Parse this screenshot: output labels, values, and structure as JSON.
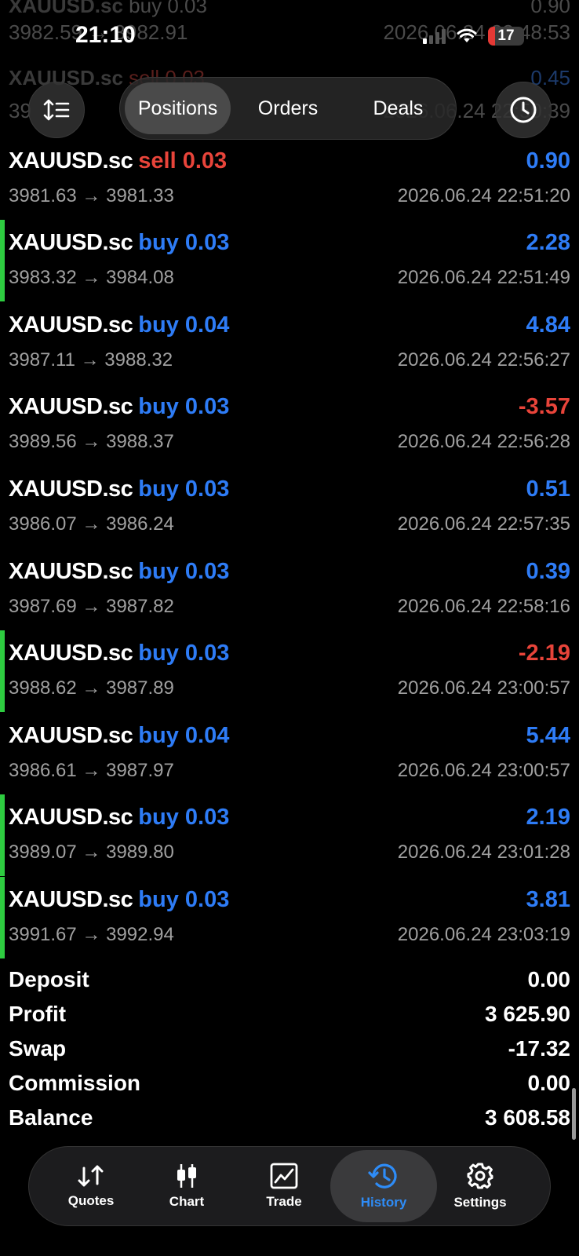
{
  "status_bar": {
    "time": "21:10",
    "battery": "17"
  },
  "ghost_rows": [
    {
      "symbol": "XAUUSD.sc",
      "side": "buy 0.03",
      "profit": "0.90",
      "prices": "3982.59 → 3982.91",
      "time": "2026.06.24 22:48:53"
    },
    {
      "symbol": "XAUUSD.sc",
      "side": "sell 0.03",
      "profit": "0.45",
      "prices": "39",
      "time": "2026.06.24 22:50:39"
    }
  ],
  "top_bar": {
    "tabs": [
      {
        "label": "Positions",
        "active": true
      },
      {
        "label": "Orders",
        "active": false
      },
      {
        "label": "Deals",
        "active": false
      }
    ]
  },
  "deals": [
    {
      "symbol": "XAUUSD.sc",
      "side": "sell",
      "side_label": "sell 0.03",
      "profit": "0.90",
      "sign": "pos",
      "prices": "3981.63 → 3981.33",
      "time": "2026.06.24 22:51:20",
      "marker": false
    },
    {
      "symbol": "XAUUSD.sc",
      "side": "buy",
      "side_label": "buy 0.03",
      "profit": "2.28",
      "sign": "pos",
      "prices": "3983.32 → 3984.08",
      "time": "2026.06.24 22:51:49",
      "marker": true
    },
    {
      "symbol": "XAUUSD.sc",
      "side": "buy",
      "side_label": "buy 0.04",
      "profit": "4.84",
      "sign": "pos",
      "prices": "3987.11 → 3988.32",
      "time": "2026.06.24 22:56:27",
      "marker": false
    },
    {
      "symbol": "XAUUSD.sc",
      "side": "buy",
      "side_label": "buy 0.03",
      "profit": "-3.57",
      "sign": "neg",
      "prices": "3989.56 → 3988.37",
      "time": "2026.06.24 22:56:28",
      "marker": false
    },
    {
      "symbol": "XAUUSD.sc",
      "side": "buy",
      "side_label": "buy 0.03",
      "profit": "0.51",
      "sign": "pos",
      "prices": "3986.07 → 3986.24",
      "time": "2026.06.24 22:57:35",
      "marker": false
    },
    {
      "symbol": "XAUUSD.sc",
      "side": "buy",
      "side_label": "buy 0.03",
      "profit": "0.39",
      "sign": "pos",
      "prices": "3987.69 → 3987.82",
      "time": "2026.06.24 22:58:16",
      "marker": false
    },
    {
      "symbol": "XAUUSD.sc",
      "side": "buy",
      "side_label": "buy 0.03",
      "profit": "-2.19",
      "sign": "neg",
      "prices": "3988.62 → 3987.89",
      "time": "2026.06.24 23:00:57",
      "marker": true
    },
    {
      "symbol": "XAUUSD.sc",
      "side": "buy",
      "side_label": "buy 0.04",
      "profit": "5.44",
      "sign": "pos",
      "prices": "3986.61 → 3987.97",
      "time": "2026.06.24 23:00:57",
      "marker": false
    },
    {
      "symbol": "XAUUSD.sc",
      "side": "buy",
      "side_label": "buy 0.03",
      "profit": "2.19",
      "sign": "pos",
      "prices": "3989.07 → 3989.80",
      "time": "2026.06.24 23:01:28",
      "marker": true
    },
    {
      "symbol": "XAUUSD.sc",
      "side": "buy",
      "side_label": "buy 0.03",
      "profit": "3.81",
      "sign": "pos",
      "prices": "3991.67 → 3992.94",
      "time": "2026.06.24 23:03:19",
      "marker": true
    }
  ],
  "summary": [
    {
      "label": "Deposit",
      "value": "0.00"
    },
    {
      "label": "Profit",
      "value": "3 625.90"
    },
    {
      "label": "Swap",
      "value": "-17.32"
    },
    {
      "label": "Commission",
      "value": "0.00"
    },
    {
      "label": "Balance",
      "value": "3 608.58"
    }
  ],
  "tabbar": [
    {
      "label": "Quotes",
      "icon": "quotes-icon",
      "active": false
    },
    {
      "label": "Chart",
      "icon": "chart-icon",
      "active": false
    },
    {
      "label": "Trade",
      "icon": "trade-icon",
      "active": false
    },
    {
      "label": "History",
      "icon": "history-icon",
      "active": true
    },
    {
      "label": "Settings",
      "icon": "gear-icon",
      "active": false
    }
  ],
  "colors": {
    "buy": "#2e7cf6",
    "sell": "#e8443a",
    "marker": "#2ecc40",
    "active_tab": "#2e8cf7"
  }
}
